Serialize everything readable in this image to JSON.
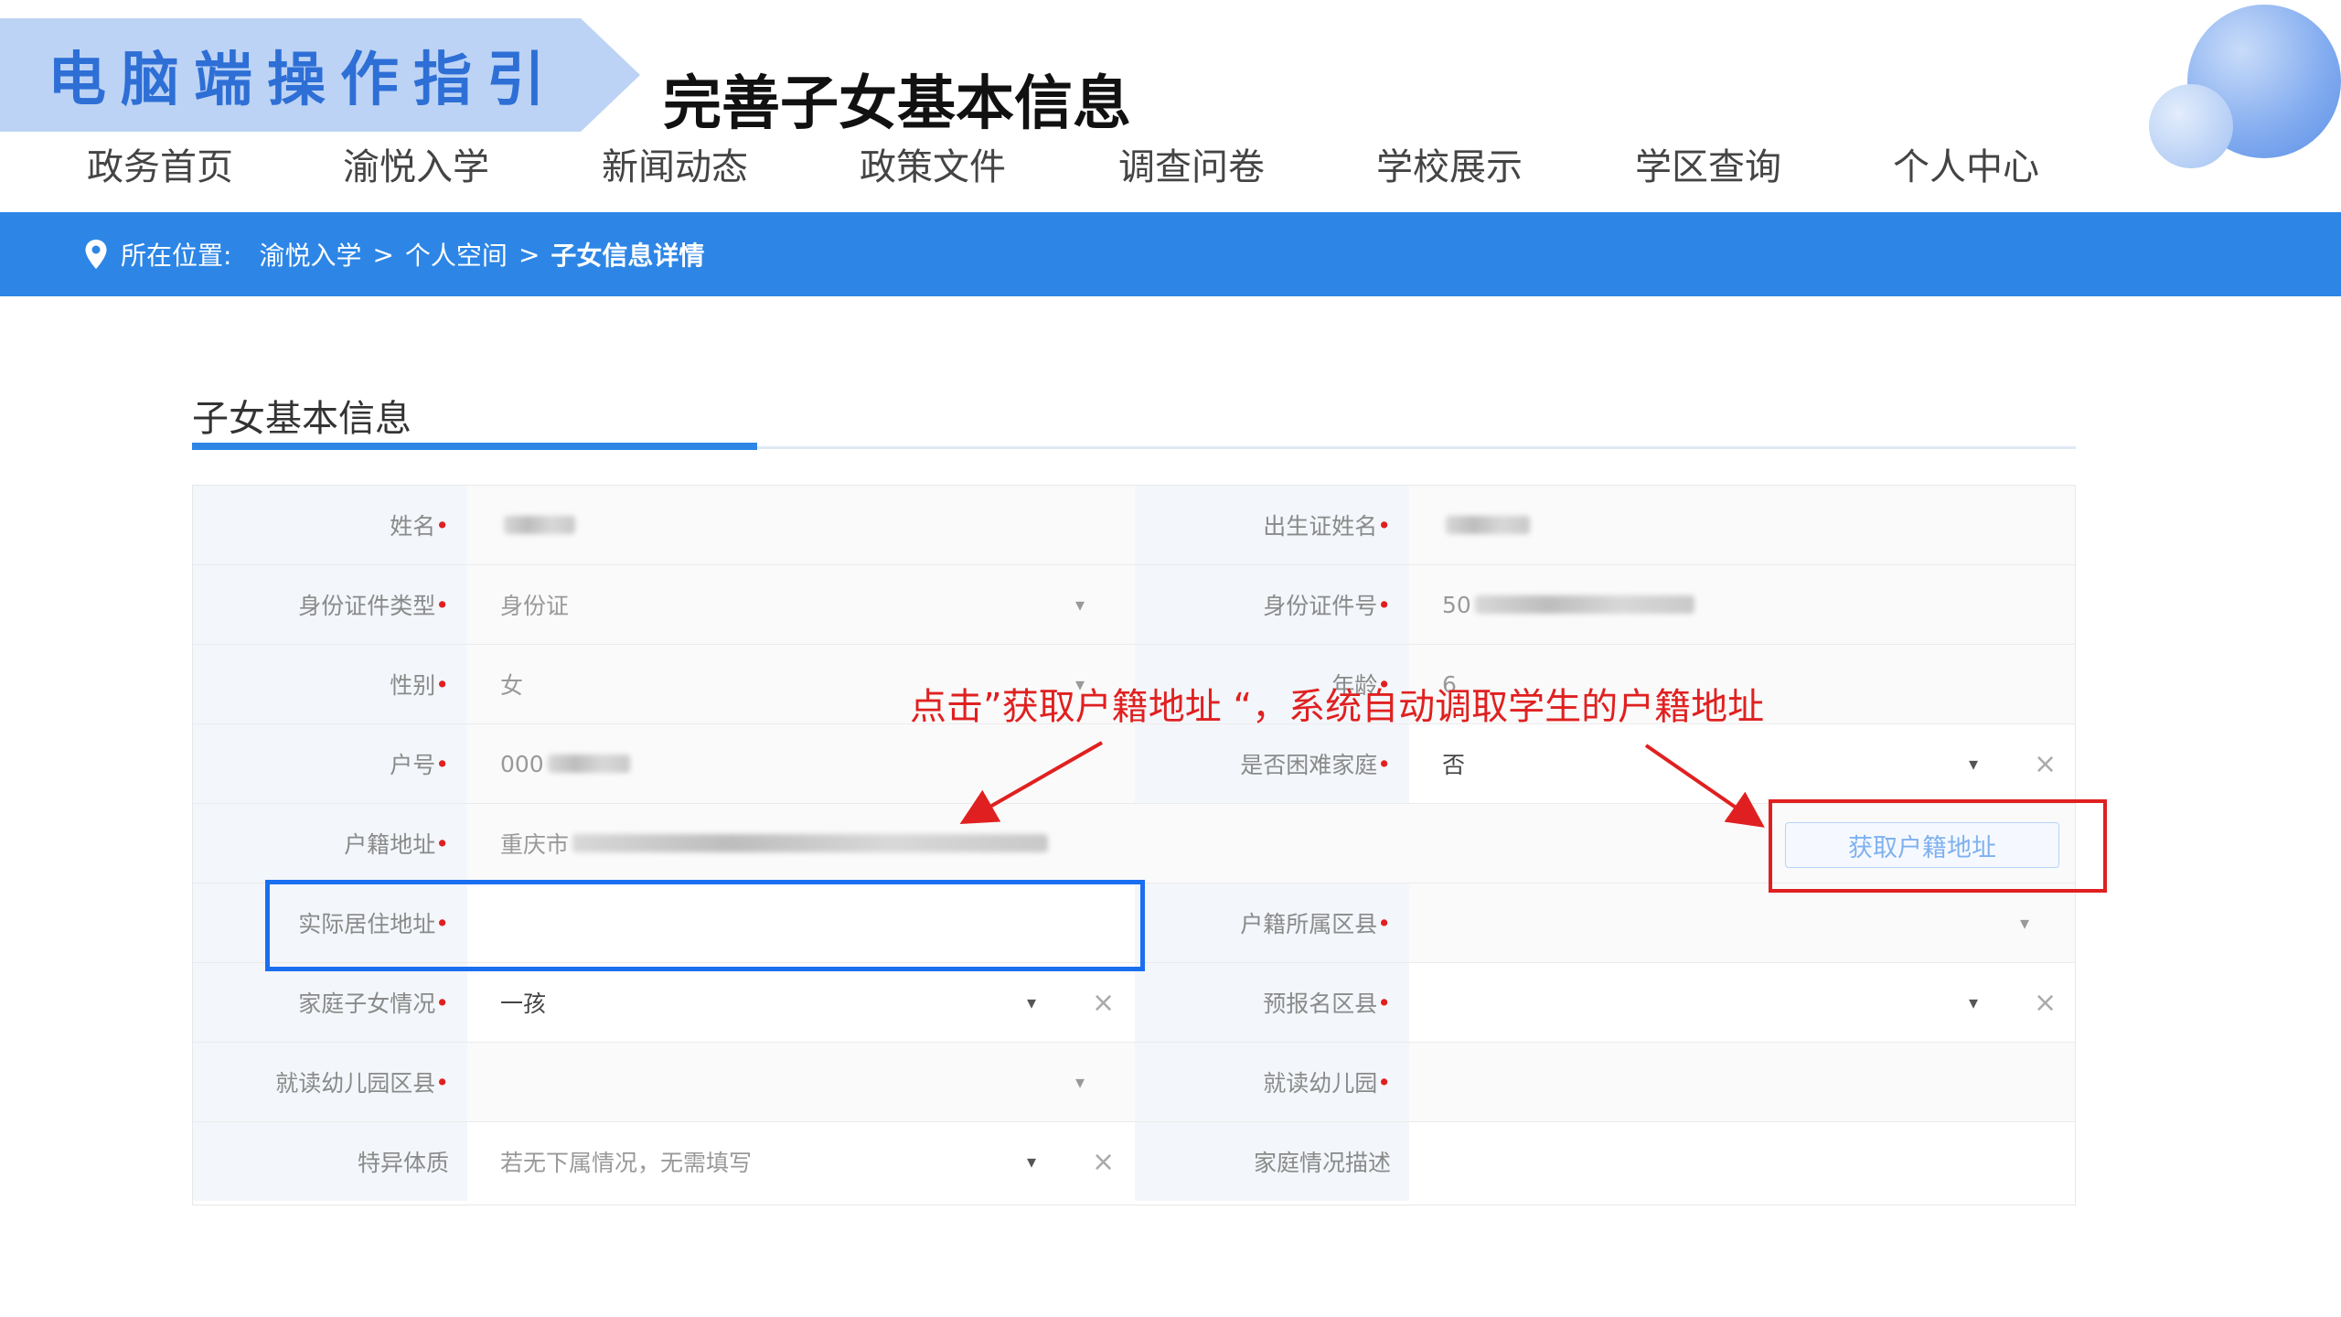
{
  "slide": {
    "banner": "电脑端操作指引",
    "title": "完善子女基本信息"
  },
  "nav": {
    "items": [
      "政务首页",
      "渝悦入学",
      "新闻动态",
      "政策文件",
      "调查问卷",
      "学校展示",
      "学区查询",
      "个人中心"
    ]
  },
  "breadcrumb": {
    "prefix": "所在位置:",
    "items": [
      "渝悦入学",
      "个人空间",
      "子女信息详情"
    ],
    "separator": ">"
  },
  "section": {
    "title": "子女基本信息"
  },
  "form": {
    "name_label": "姓名",
    "birth_cert_name_label": "出生证姓名",
    "id_type_label": "身份证件类型",
    "id_type_value": "身份证",
    "id_number_label": "身份证件号",
    "id_number_value": "50",
    "gender_label": "性别",
    "gender_value": "女",
    "age_label": "年龄",
    "age_value": "6",
    "household_no_label": "户号",
    "household_no_value": "000",
    "hardship_label": "是否困难家庭",
    "hardship_value": "否",
    "hukou_address_label": "户籍地址",
    "hukou_address_value": "重庆市",
    "get_hukou_button": "获取户籍地址",
    "actual_address_label": "实际居住地址",
    "hukou_district_label": "户籍所属区县",
    "children_label": "家庭子女情况",
    "children_value": "一孩",
    "prereg_district_label": "预报名区县",
    "kinder_district_label": "就读幼儿园区县",
    "kindergarten_label": "就读幼儿园",
    "special_label": "特异体质",
    "special_placeholder": "若无下属情况，无需填写",
    "family_desc_label": "家庭情况描述",
    "required_mark": "•"
  },
  "annotation": {
    "text": "点击”获取户籍地址 “，系统自动调取学生的户籍地址"
  },
  "colors": {
    "brand_blue": "#2d86e6",
    "annotation_red": "#e02020",
    "highlight_blue": "#1a6ff0"
  }
}
